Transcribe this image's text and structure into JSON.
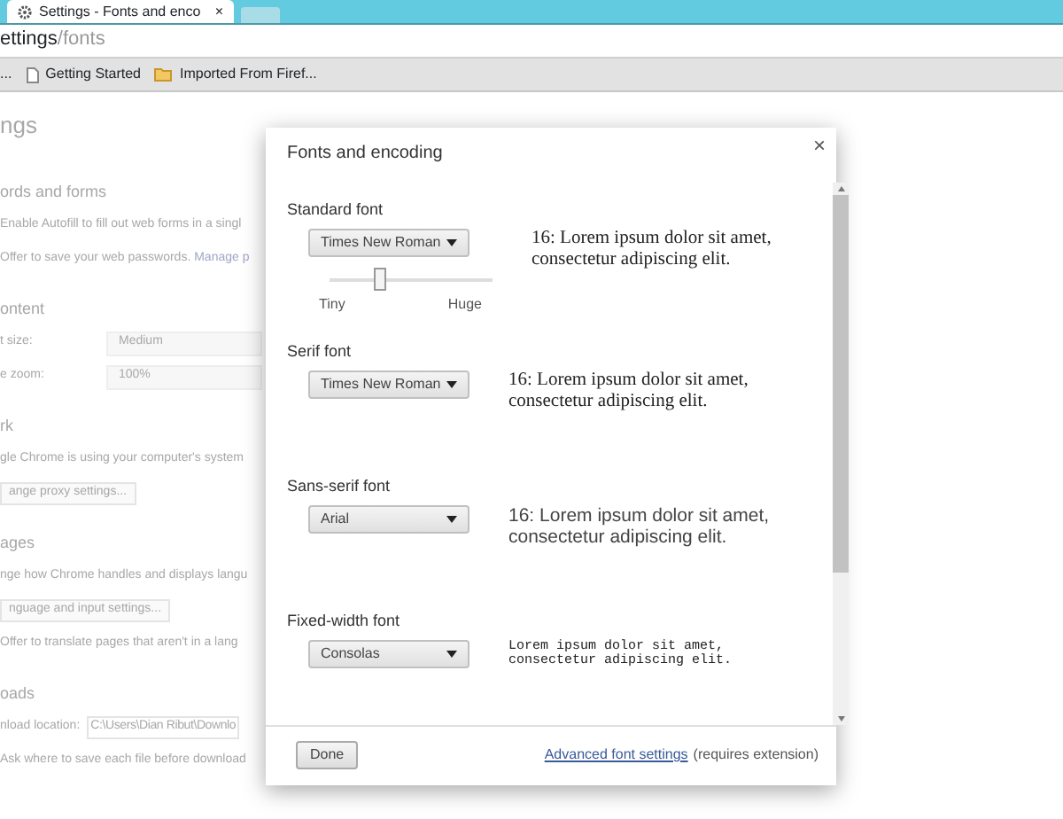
{
  "browser": {
    "tab": {
      "title": "Settings - Fonts and enco",
      "close": "×"
    },
    "address": {
      "host": "ettings",
      "path": "/fonts"
    },
    "bookmarks": [
      {
        "label": "...",
        "kind": "overflow"
      },
      {
        "label": "Getting Started",
        "kind": "page"
      },
      {
        "label": "Imported From Firef...",
        "kind": "folder"
      }
    ]
  },
  "settings_page": {
    "title": "ngs",
    "sections": [
      {
        "heading": "ords and forms",
        "items": [
          {
            "kind": "text",
            "text": "Enable Autofill to fill out web forms in a singl"
          },
          {
            "kind": "text_link",
            "text": "Offer to save your web passwords.",
            "link": "Manage p"
          }
        ]
      },
      {
        "heading": "ontent",
        "items": [
          {
            "kind": "select",
            "label": "t size:",
            "value": "Medium"
          },
          {
            "kind": "select",
            "label": "e zoom:",
            "value": "100%"
          }
        ]
      },
      {
        "heading": "rk",
        "items": [
          {
            "kind": "text",
            "text": "gle Chrome is using your computer's system"
          },
          {
            "kind": "button",
            "label": "ange proxy settings..."
          }
        ]
      },
      {
        "heading": "ages",
        "items": [
          {
            "kind": "text",
            "text": "nge how Chrome handles and displays langu"
          },
          {
            "kind": "button",
            "label": "nguage and input settings..."
          },
          {
            "kind": "text",
            "text": "Offer to translate pages that aren't in a lang"
          }
        ]
      },
      {
        "heading": "oads",
        "items": [
          {
            "kind": "field",
            "label": "nload location:",
            "value": "C:\\Users\\Dian Ribut\\Downlo"
          },
          {
            "kind": "text",
            "text": "Ask where to save each file before download"
          }
        ]
      }
    ]
  },
  "dialog": {
    "title": "Fonts and encoding",
    "close": "×",
    "fonts": [
      {
        "label": "Standard font",
        "value": "Times New Roman",
        "kind": "serif",
        "preview": "16: Lorem ipsum dolor sit amet, consectetur adipiscing elit.",
        "slider": {
          "level": 0.3,
          "min_label": "Tiny",
          "max_label": "Huge"
        }
      },
      {
        "label": "Serif font",
        "value": "Times New Roman",
        "kind": "serif",
        "preview": "16: Lorem ipsum dolor sit amet, consectetur adipiscing elit."
      },
      {
        "label": "Sans-serif font",
        "value": "Arial",
        "kind": "sans",
        "preview": "16: Lorem ipsum dolor sit amet, consectetur adipiscing elit."
      },
      {
        "label": "Fixed-width font",
        "value": "Consolas",
        "kind": "mono",
        "preview": "Lorem ipsum dolor sit amet, consectetur adipiscing elit."
      }
    ],
    "done": "Done",
    "link": "Advanced font settings",
    "note": "(requires extension)"
  }
}
